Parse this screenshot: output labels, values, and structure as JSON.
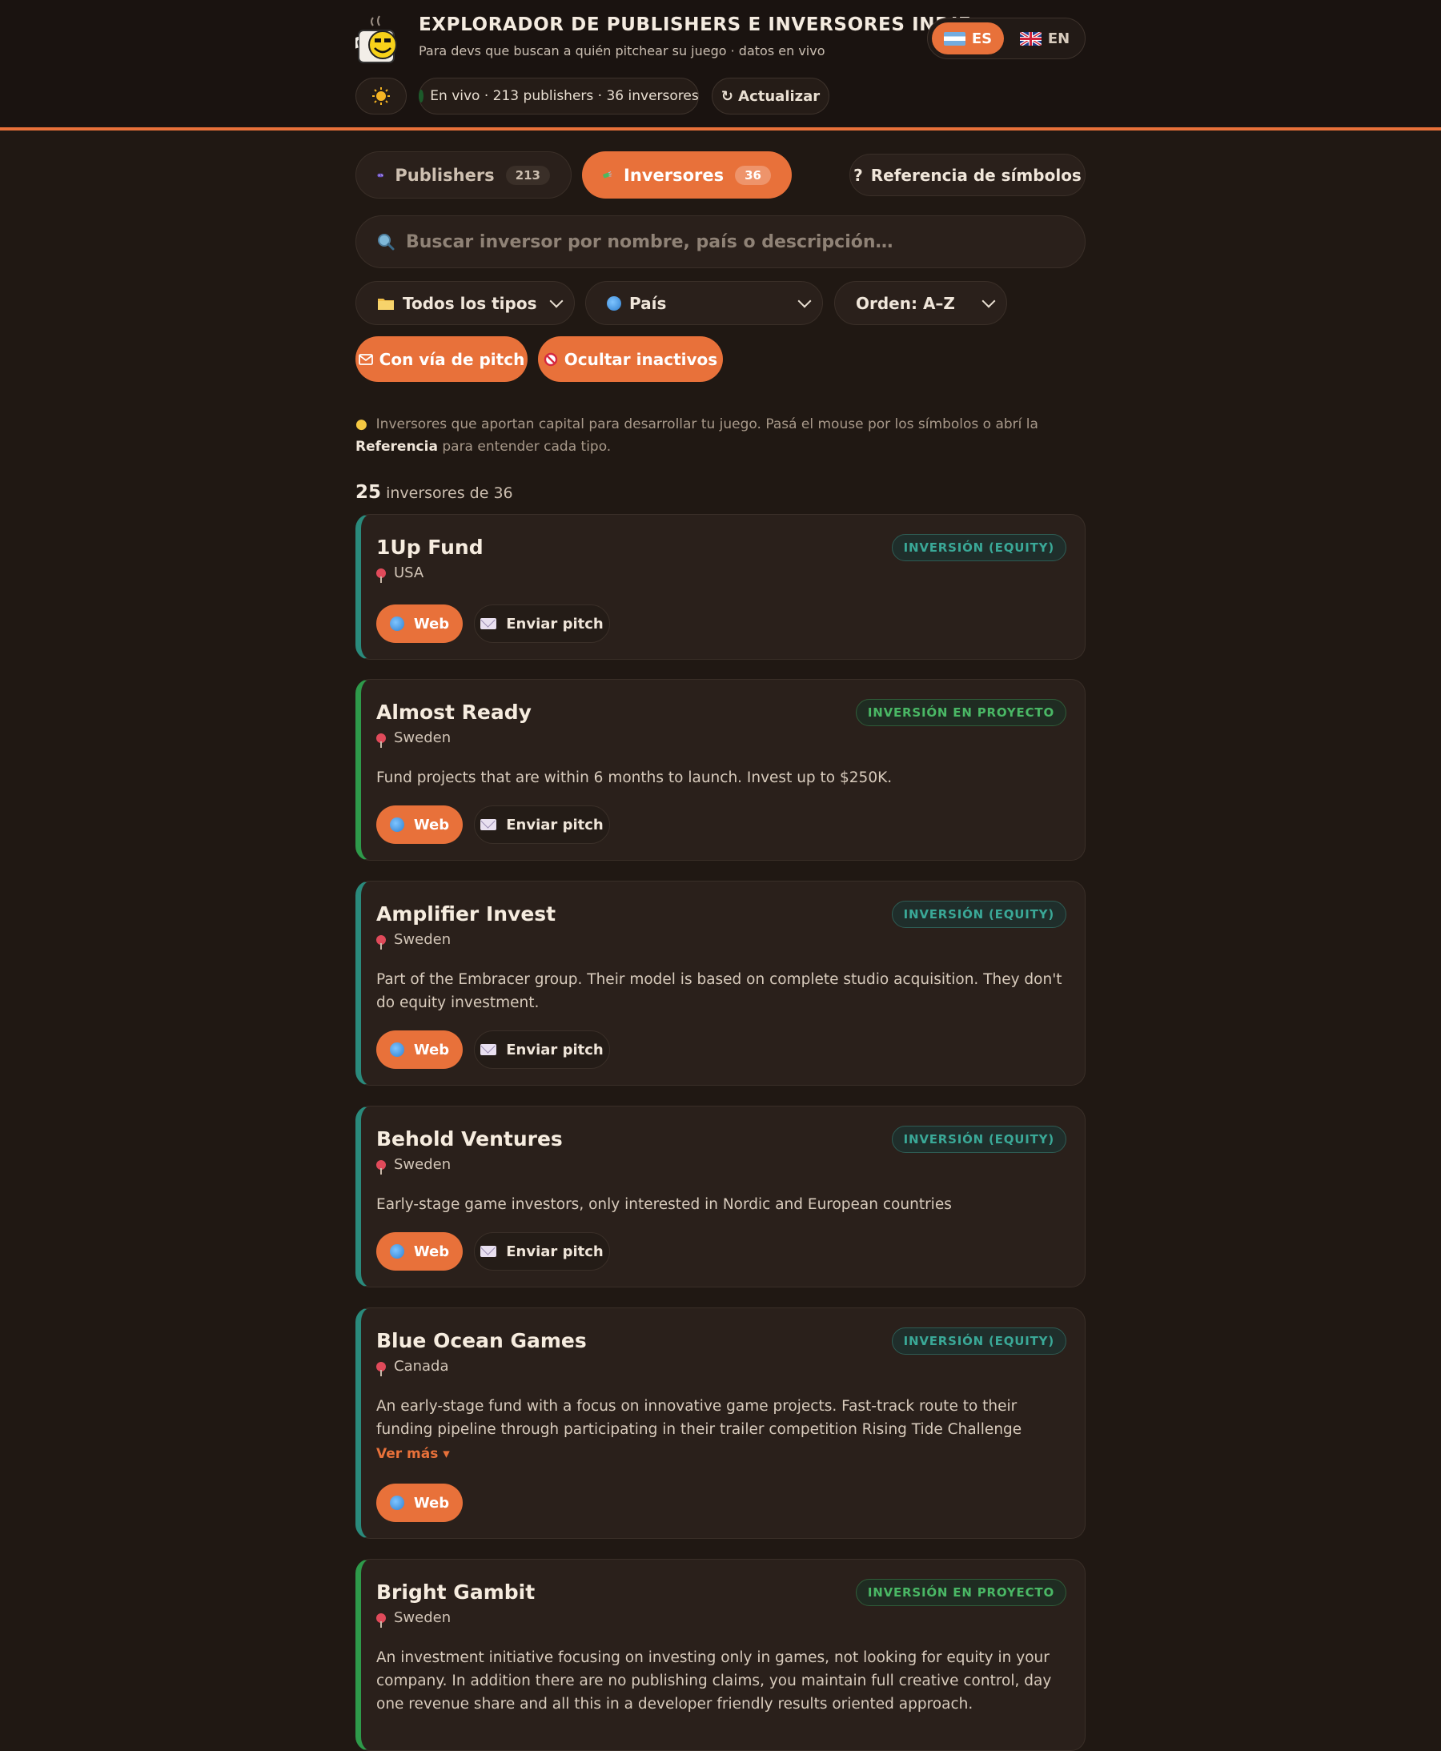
{
  "header": {
    "title": "EXPLORADOR DE PUBLISHERS E INVERSORES INDIE",
    "subtitle": "Para devs que buscan a quién pitchear su juego · datos en vivo",
    "languages": [
      {
        "code": "ES",
        "active": true
      },
      {
        "code": "EN",
        "active": false
      }
    ],
    "theme_icon": "sun-icon",
    "status_text": "En vivo · 213 publishers · 36 inversores",
    "refresh_label": "↻ Actualizar"
  },
  "tabs": [
    {
      "label": "Publishers",
      "count": "213",
      "active": false,
      "icon": "gamepad-icon"
    },
    {
      "label": "Inversores",
      "count": "36",
      "active": true,
      "icon": "money-icon"
    }
  ],
  "reference_label": "Referencia de símbolos",
  "search": {
    "placeholder": "Buscar inversor por nombre, país o descripción…"
  },
  "filters": {
    "type_select": "Todos los tipos",
    "country_select": "País",
    "order_select": "Orden: A–Z",
    "pitch_chip": "Con vía de pitch",
    "inactive_chip": "Ocultar inactivos"
  },
  "hint": {
    "text_before": "Inversores que aportan capital para desarrollar tu juego. Pasá el mouse por los símbolos o abrí la ",
    "link": "Referencia",
    "text_after": " para entender cada tipo."
  },
  "results": {
    "shown": "25",
    "suffix": "inversores de 36"
  },
  "labels": {
    "web": "Web",
    "pitch": "Enviar pitch",
    "more": "Ver más ▾"
  },
  "colors": {
    "accent": "#e8713a",
    "equity": "#3aa897",
    "project": "#4ab865"
  },
  "investors": [
    {
      "name": "1Up Fund",
      "country": "USA",
      "badge": "INVERSIÓN (EQUITY)",
      "type": "equity",
      "description": "",
      "has_pitch": true
    },
    {
      "name": "Almost Ready",
      "country": "Sweden",
      "badge": "INVERSIÓN EN PROYECTO",
      "type": "project",
      "description": "Fund projects that are within 6 months to launch. Invest up to $250K.",
      "has_pitch": true
    },
    {
      "name": "Amplifier Invest",
      "country": "Sweden",
      "badge": "INVERSIÓN (EQUITY)",
      "type": "equity",
      "description": "Part of the Embracer group. Their model is based on complete studio acquisition. They don't do equity investment.",
      "has_pitch": true
    },
    {
      "name": "Behold Ventures",
      "country": "Sweden",
      "badge": "INVERSIÓN (EQUITY)",
      "type": "equity",
      "description": "Early-stage game investors, only interested in Nordic and European countries",
      "has_pitch": true
    },
    {
      "name": "Blue Ocean Games",
      "country": "Canada",
      "badge": "INVERSIÓN (EQUITY)",
      "type": "equity",
      "description": "An early-stage fund with a focus on innovative game projects. Fast-track route to their funding pipeline through participating in their trailer competition Rising Tide Challenge",
      "has_pitch": false
    },
    {
      "name": "Bright Gambit",
      "country": "Sweden",
      "badge": "INVERSIÓN EN PROYECTO",
      "type": "project",
      "description": "An investment initiative focusing on investing only in games, not looking for equity in your company. In addition there are no publishing claims, you maintain full creative control, day one revenue share and all this in a developer friendly results oriented approach.",
      "has_pitch": false
    }
  ]
}
